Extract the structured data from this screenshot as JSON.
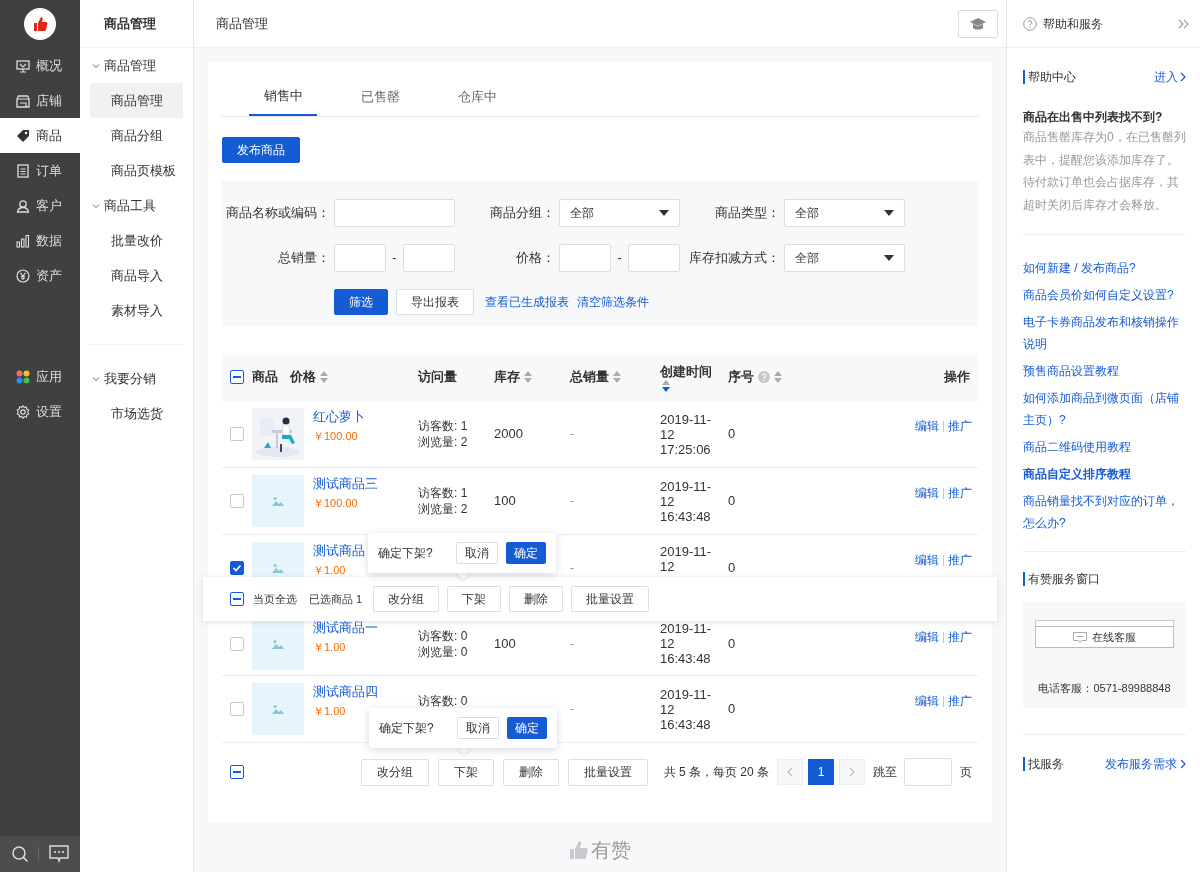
{
  "main_nav": [
    {
      "label": "概况",
      "selected": false
    },
    {
      "label": "店铺",
      "selected": false
    },
    {
      "label": "商品",
      "selected": true
    },
    {
      "label": "订单",
      "selected": false
    },
    {
      "label": "客户",
      "selected": false
    },
    {
      "label": "数据",
      "selected": false
    },
    {
      "label": "资产",
      "selected": false
    }
  ],
  "main_nav_bottom": [
    {
      "label": "应用",
      "selected": false
    },
    {
      "label": "设置",
      "selected": false
    }
  ],
  "sub_nav": {
    "title": "商品管理",
    "groups": [
      {
        "label": "商品管理",
        "expanded": true,
        "items": [
          {
            "label": "商品管理",
            "selected": true
          },
          {
            "label": "商品分组",
            "selected": false
          },
          {
            "label": "商品页模板",
            "selected": false
          }
        ]
      },
      {
        "label": "商品工具",
        "expanded": true,
        "items": [
          {
            "label": "批量改价",
            "selected": false
          },
          {
            "label": "商品导入",
            "selected": false
          },
          {
            "label": "素材导入",
            "selected": false
          }
        ]
      },
      {
        "label": "我要分销",
        "expanded": true,
        "items": [
          {
            "label": "市场选货",
            "selected": false
          }
        ]
      }
    ]
  },
  "header": {
    "title": "商品管理"
  },
  "tabs": [
    {
      "label": "销售中",
      "selected": true
    },
    {
      "label": "已售罄",
      "selected": false
    },
    {
      "label": "仓库中",
      "selected": false
    }
  ],
  "publish_button": "发布商品",
  "filters": [
    {
      "kind": "text",
      "label": "商品名称或编码："
    },
    {
      "kind": "select",
      "label": "商品分组：",
      "value": "全部"
    },
    {
      "kind": "select",
      "label": "商品类型：",
      "value": "全部"
    },
    {
      "kind": "range",
      "label": "总销量：",
      "separator": "-"
    },
    {
      "kind": "range",
      "label": "价格：",
      "separator": "-"
    },
    {
      "kind": "select",
      "label": "库存扣减方式：",
      "value": "全部"
    }
  ],
  "filter_actions": [
    {
      "kind": "primary",
      "label": "筛选"
    },
    {
      "kind": "button",
      "label": "导出报表"
    },
    {
      "kind": "link",
      "label": "查看已生成报表"
    },
    {
      "kind": "link",
      "label": "清空筛选条件"
    }
  ],
  "table": {
    "indeterminate": true,
    "columns": [
      {
        "label": "商品"
      },
      {
        "label": "价格",
        "sortable": true,
        "sort_active": false
      },
      {
        "label": "访问量"
      },
      {
        "label": "库存",
        "sortable": true,
        "sort_active": false
      },
      {
        "label": "总销量",
        "sortable": true,
        "sort_active": false
      },
      {
        "label": "创建时间",
        "sortable": true,
        "sort_active": true
      },
      {
        "label": "序号",
        "help": true,
        "sortable": true,
        "sort_active": false
      },
      {
        "label": "操作"
      }
    ],
    "rows": [
      {
        "checked": false,
        "kind": "picture",
        "name": "红心萝卜",
        "price": "￥100.00",
        "visits": [
          "访客数: 1",
          "浏览量: 2"
        ],
        "stock": "2000",
        "sales": "-",
        "created": "2019-11-12 17:25:06",
        "seq": "0",
        "actions": [
          "编辑",
          "推广"
        ]
      },
      {
        "checked": false,
        "kind": "placeholder",
        "name": "测试商品三",
        "price": "￥100.00",
        "visits": [
          "访客数: 1",
          "浏览量: 2"
        ],
        "stock": "100",
        "sales": "-",
        "created": "2019-11-12 16:43:48",
        "seq": "0",
        "actions": [
          "编辑",
          "推广"
        ]
      },
      {
        "checked": true,
        "kind": "placeholder",
        "name": "测试商品",
        "price": "￥1.00",
        "visits": [],
        "sales": "-",
        "created": "2019-11-12",
        "seq": "0",
        "actions": [
          "编辑",
          "推广"
        ]
      },
      {
        "checked": false,
        "kind": "placeholder",
        "name": "测试商品一",
        "price": "￥1.00",
        "visits": [
          "访客数: 0",
          "浏览量: 0"
        ],
        "stock": "100",
        "sales": "-",
        "created": "2019-11-12 16:43:48",
        "seq": "0",
        "actions": [
          "编辑",
          "推广"
        ]
      },
      {
        "checked": false,
        "kind": "placeholder",
        "name": "测试商品四",
        "price": "￥1.00",
        "visits": [
          "访客数: 0"
        ],
        "sales": "-",
        "created": "2019-11-12 16:43:48",
        "seq": "0",
        "actions": [
          "编辑",
          "推广"
        ]
      }
    ]
  },
  "batch_bar": {
    "indeterminate": true,
    "select_all": "当页全选",
    "selected_count": "已选商品 1",
    "buttons": [
      "改分组",
      "下架",
      "删除",
      "批量设置"
    ]
  },
  "popovers": [
    {
      "text": "确定下架?",
      "cancel": "取消",
      "confirm": "确定"
    },
    {
      "text": "确定下架?",
      "cancel": "取消",
      "confirm": "确定"
    }
  ],
  "footer_bar": {
    "indeterminate": true,
    "buttons": [
      "改分组",
      "下架",
      "删除",
      "批量设置"
    ],
    "summary": "共 5 条，每页 20 条",
    "pages": [
      {
        "label": "1",
        "selected": true
      }
    ],
    "jump_label": "跳至",
    "page_suffix": "页"
  },
  "brand_footer": "有赞",
  "help": {
    "title": "帮助和服务",
    "center": {
      "title": "帮助中心",
      "enter": "进入",
      "question": "商品在出售中列表找不到?",
      "answer": "商品售罄库存为0，在已售罄列表中，提醒您该添加库存了。待付款订单也会占据库存，其超时关闭后库存才会释放。"
    },
    "links": [
      {
        "label": "如何新建 / 发布商品?",
        "bold": false
      },
      {
        "label": "商品会员价如何自定义设置?",
        "bold": false
      },
      {
        "label": "电子卡券商品发布和核销操作说明",
        "bold": false
      },
      {
        "label": "预售商品设置教程",
        "bold": false
      },
      {
        "label": "如何添加商品到微页面（店铺主页）?",
        "bold": false
      },
      {
        "label": "商品二维码使用教程",
        "bold": false
      },
      {
        "label": "商品自定义排序教程",
        "bold": true
      },
      {
        "label": "商品销量找不到对应的订单，怎么办?",
        "bold": false
      }
    ],
    "service": {
      "title": "有赞服务窗口",
      "button": "在线客服",
      "phone": "电话客服：0571-89988848"
    },
    "find": {
      "title": "找服务",
      "link": "发布服务需求"
    }
  }
}
